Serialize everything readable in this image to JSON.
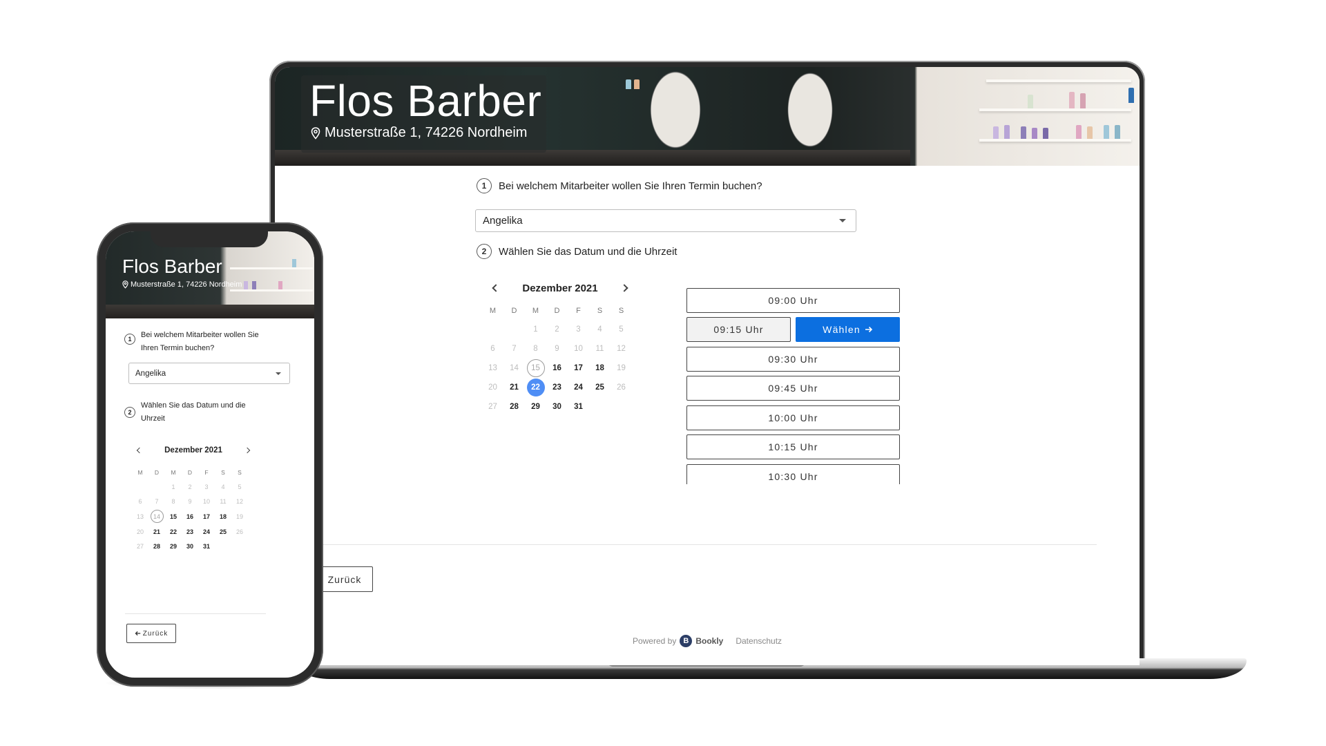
{
  "business": {
    "name": "Flos Barber",
    "address": "Musterstraße 1, 74226 Nordheim"
  },
  "step1": {
    "number": "1",
    "question": "Bei welchem Mitarbeiter wollen Sie Ihren Termin buchen?",
    "question_line1": "Bei welchem Mitarbeiter wollen Sie",
    "question_line2": "Ihren Termin buchen?",
    "selected_staff": "Angelika"
  },
  "step2": {
    "number": "2",
    "question": "Wählen Sie das Datum und die Uhrzeit",
    "question_line1": "Wählen Sie das Datum und die",
    "question_line2": "Uhrzeit"
  },
  "calendar": {
    "month_label": "Dezember 2021",
    "weekdays": [
      "M",
      "D",
      "M",
      "D",
      "F",
      "S",
      "S"
    ]
  },
  "laptop_calendar": {
    "days": [
      {
        "t": "",
        "s": "off"
      },
      {
        "t": "",
        "s": "off"
      },
      {
        "t": "1",
        "s": "off"
      },
      {
        "t": "2",
        "s": "off"
      },
      {
        "t": "3",
        "s": "off"
      },
      {
        "t": "4",
        "s": "off"
      },
      {
        "t": "5",
        "s": "off"
      },
      {
        "t": "6",
        "s": "off"
      },
      {
        "t": "7",
        "s": "off"
      },
      {
        "t": "8",
        "s": "off"
      },
      {
        "t": "9",
        "s": "off"
      },
      {
        "t": "10",
        "s": "off"
      },
      {
        "t": "11",
        "s": "off"
      },
      {
        "t": "12",
        "s": "off"
      },
      {
        "t": "13",
        "s": "off"
      },
      {
        "t": "14",
        "s": "off"
      },
      {
        "t": "15",
        "s": "today"
      },
      {
        "t": "16",
        "s": "on"
      },
      {
        "t": "17",
        "s": "on"
      },
      {
        "t": "18",
        "s": "on"
      },
      {
        "t": "19",
        "s": "off"
      },
      {
        "t": "20",
        "s": "off"
      },
      {
        "t": "21",
        "s": "on"
      },
      {
        "t": "22",
        "s": "sel"
      },
      {
        "t": "23",
        "s": "on"
      },
      {
        "t": "24",
        "s": "on"
      },
      {
        "t": "25",
        "s": "on"
      },
      {
        "t": "26",
        "s": "off"
      },
      {
        "t": "27",
        "s": "off"
      },
      {
        "t": "28",
        "s": "on"
      },
      {
        "t": "29",
        "s": "on"
      },
      {
        "t": "30",
        "s": "on"
      },
      {
        "t": "31",
        "s": "on"
      },
      {
        "t": "",
        "s": "off"
      },
      {
        "t": "",
        "s": "off"
      }
    ]
  },
  "phone_calendar": {
    "days": [
      {
        "t": "",
        "s": "off"
      },
      {
        "t": "",
        "s": "off"
      },
      {
        "t": "1",
        "s": "off"
      },
      {
        "t": "2",
        "s": "off"
      },
      {
        "t": "3",
        "s": "off"
      },
      {
        "t": "4",
        "s": "off"
      },
      {
        "t": "5",
        "s": "off"
      },
      {
        "t": "6",
        "s": "off"
      },
      {
        "t": "7",
        "s": "off"
      },
      {
        "t": "8",
        "s": "off"
      },
      {
        "t": "9",
        "s": "off"
      },
      {
        "t": "10",
        "s": "off"
      },
      {
        "t": "11",
        "s": "off"
      },
      {
        "t": "12",
        "s": "off"
      },
      {
        "t": "13",
        "s": "off"
      },
      {
        "t": "14",
        "s": "today"
      },
      {
        "t": "15",
        "s": "on"
      },
      {
        "t": "16",
        "s": "on"
      },
      {
        "t": "17",
        "s": "on"
      },
      {
        "t": "18",
        "s": "on"
      },
      {
        "t": "19",
        "s": "off"
      },
      {
        "t": "20",
        "s": "off"
      },
      {
        "t": "21",
        "s": "on"
      },
      {
        "t": "22",
        "s": "on"
      },
      {
        "t": "23",
        "s": "on"
      },
      {
        "t": "24",
        "s": "on"
      },
      {
        "t": "25",
        "s": "on"
      },
      {
        "t": "26",
        "s": "off"
      },
      {
        "t": "27",
        "s": "off"
      },
      {
        "t": "28",
        "s": "on"
      },
      {
        "t": "29",
        "s": "on"
      },
      {
        "t": "30",
        "s": "on"
      },
      {
        "t": "31",
        "s": "on"
      },
      {
        "t": "",
        "s": "off"
      },
      {
        "t": "",
        "s": "off"
      }
    ]
  },
  "time_slots": {
    "slot_0900": "09:00 Uhr",
    "slot_0915": "09:15 Uhr",
    "choose_label": "Wählen",
    "slot_0930": "09:30 Uhr",
    "slot_0945": "09:45 Uhr",
    "slot_1000": "10:00 Uhr",
    "slot_1015": "10:15 Uhr",
    "slot_1030": "10:30 Uhr"
  },
  "nav": {
    "back_label": "Zurück"
  },
  "footer": {
    "powered_by": "Powered by",
    "bookly_letter": "B",
    "bookly_name": "Bookly",
    "privacy": "Datenschutz"
  },
  "colors": {
    "accent": "#0c6fe0",
    "selected_day": "#4f8ef5",
    "brand_dark": "#2c3e66"
  },
  "icons": {
    "location": "map-pin-icon",
    "dropdown": "caret-down-icon",
    "prev": "chevron-left-icon",
    "next": "chevron-right-icon",
    "arrow": "arrow-right-icon",
    "back_arrow": "arrow-left-icon"
  }
}
